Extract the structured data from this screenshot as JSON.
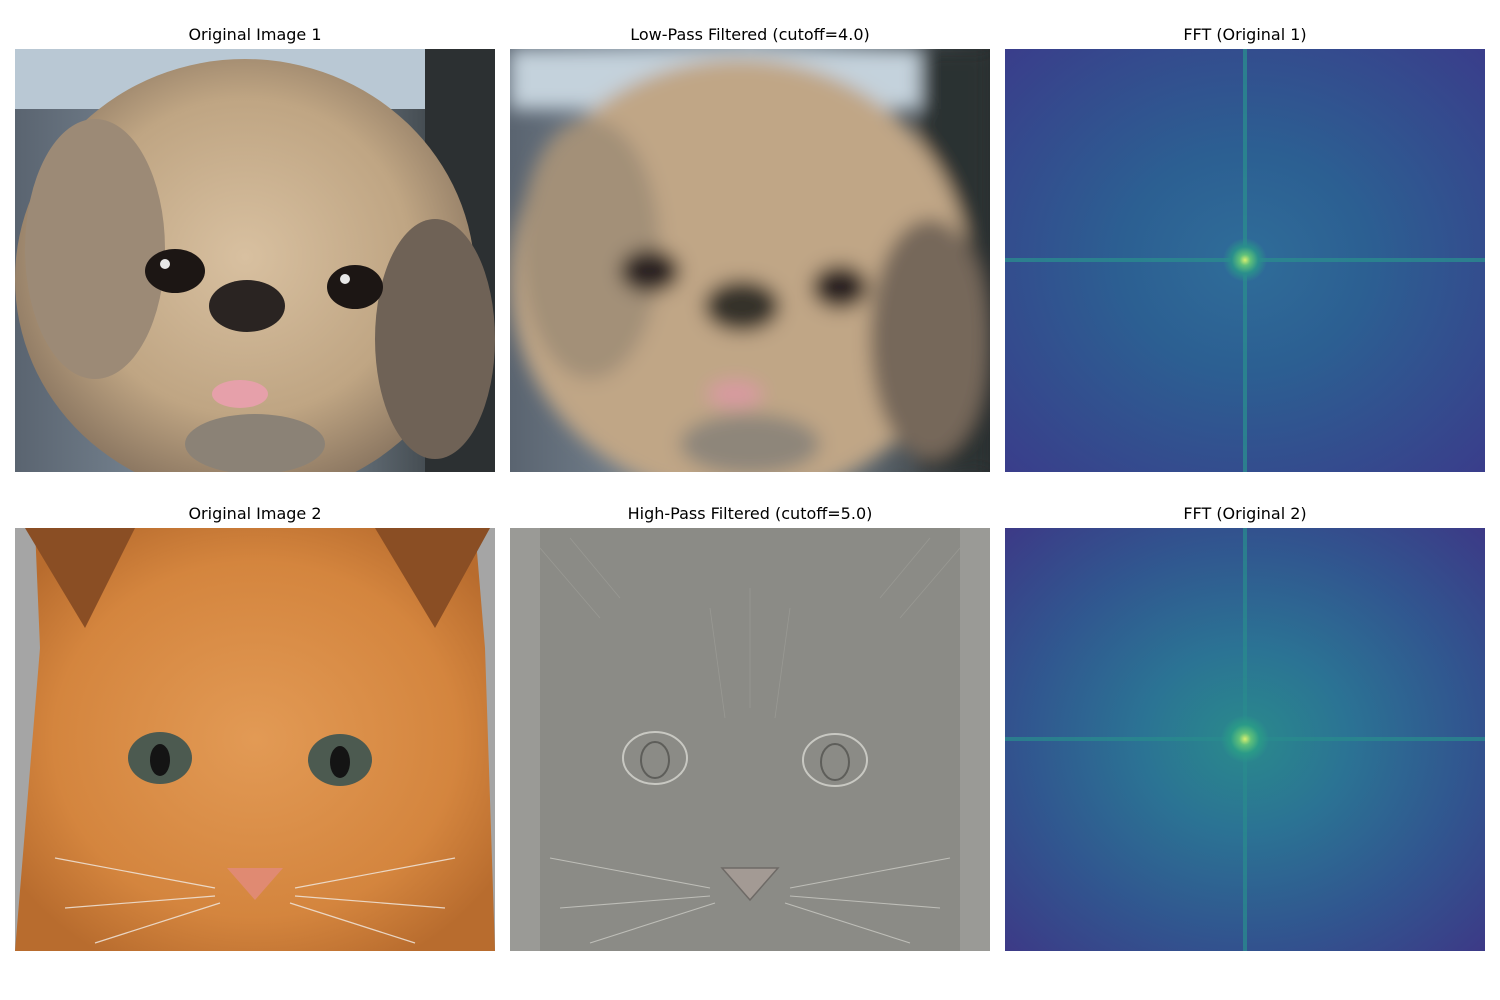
{
  "panels": [
    {
      "title": "Original Image 1",
      "subject": "dog"
    },
    {
      "title": "Low-Pass Filtered (cutoff=4.0)",
      "subject": "dog-blurred"
    },
    {
      "title": "FFT (Original 1)",
      "subject": "fft-spectrum"
    },
    {
      "title": "Original Image 2",
      "subject": "cat"
    },
    {
      "title": "High-Pass Filtered (cutoff=5.0)",
      "subject": "cat-edges"
    },
    {
      "title": "FFT (Original 2)",
      "subject": "fft-spectrum"
    }
  ],
  "colors": {
    "background": "#ffffff",
    "fft_outer": "#3b3a8a",
    "fft_mid": "#2f6d99",
    "fft_center": "#a8e060",
    "dog_fur": "#c8ad8c",
    "cat_fur": "#d98b45",
    "highpass_gray": "#8b8b86"
  }
}
